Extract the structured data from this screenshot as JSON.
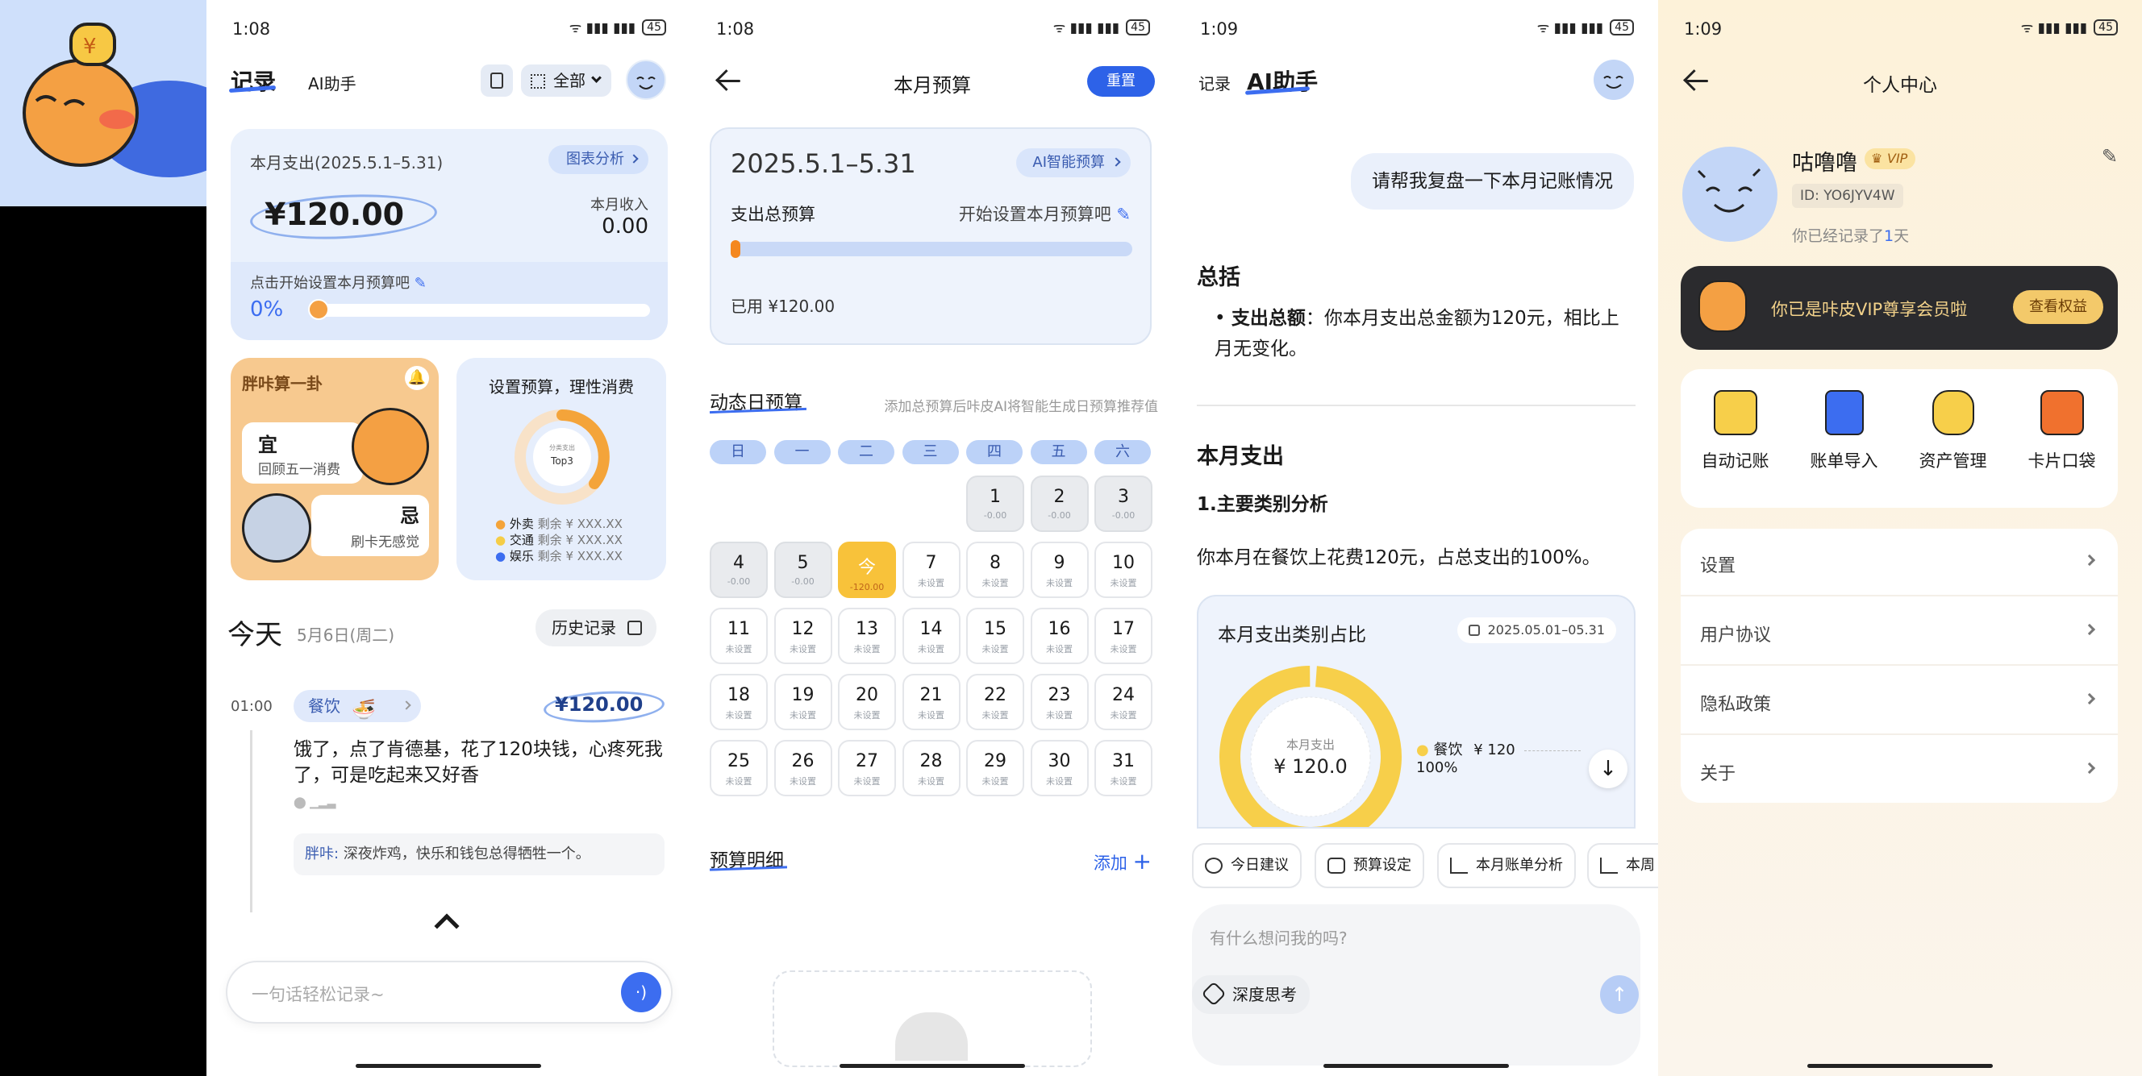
{
  "status": {
    "time1": "1:08",
    "time2": "1:08",
    "time3": "1:09",
    "time4": "1:09",
    "battery": "45",
    "signal": "ᯤ ▮▮▮ ▮▮▮"
  },
  "p1": {
    "tab_record": "记录",
    "tab_ai": "AI助手",
    "filter": "全部",
    "expense_title": "本月支出(2025.5.1–5.31)",
    "chart_btn": "图表分析",
    "expense_amount": "¥120.00",
    "income_label": "本月收入",
    "income_value": "0.00",
    "budget_hint": "点击开始设置本月预算吧",
    "budget_pct": "0%",
    "fortune_title": "胖咔算一卦",
    "yi": "宜",
    "yi_text": "回顾五一消费",
    "ji": "忌",
    "ji_text": "刷卡无感觉",
    "budget_card_title": "设置预算，理性消费",
    "donut_small": "分类支出",
    "donut_top": "Top3",
    "cats": [
      {
        "name": "外卖",
        "text": "剩余 ¥ XXX.XX",
        "color": "#f4a43a"
      },
      {
        "name": "交通",
        "text": "剩余 ¥ XXX.XX",
        "color": "#f5cd47"
      },
      {
        "name": "娱乐",
        "text": "剩余 ¥ XXX.XX",
        "color": "#3c6df0"
      }
    ],
    "today": "今天",
    "date": "5月6日(周二)",
    "history": "历史记录",
    "entry_time": "01:00",
    "entry_cat": "餐饮",
    "entry_amount": "¥120.00",
    "entry_text": "饿了，点了肯德基，花了120块钱，心疼死我了，可是吃起来又好香",
    "ai_reply_name": "胖咔:",
    "ai_reply": "深夜炸鸡，快乐和钱包总得牺牲一个。",
    "input_placeholder": "一句话轻松记录~"
  },
  "p2": {
    "title": "本月预算",
    "reset": "重置",
    "period": "2025.5.1–5.31",
    "ai_budget": "AI智能预算",
    "total_label": "支出总预算",
    "set_hint": "开始设置本月预算吧",
    "used": "已用 ¥120.00",
    "daily_title": "动态日预算",
    "daily_hint": "添加总预算后咔皮AI将智能生成日预算推荐值",
    "weekdays": [
      "日",
      "一",
      "二",
      "三",
      "四",
      "五",
      "六"
    ],
    "days": [
      {
        "d": "1",
        "s": "-0.00"
      },
      {
        "d": "2",
        "s": "-0.00"
      },
      {
        "d": "3",
        "s": "-0.00"
      },
      {
        "d": "4",
        "s": "-0.00"
      },
      {
        "d": "5",
        "s": "-0.00"
      },
      {
        "d": "今",
        "s": "-120.00"
      },
      {
        "d": "7",
        "s": "未设置"
      },
      {
        "d": "8",
        "s": "未设置"
      },
      {
        "d": "9",
        "s": "未设置"
      },
      {
        "d": "10",
        "s": "未设置"
      },
      {
        "d": "11",
        "s": "未设置"
      },
      {
        "d": "12",
        "s": "未设置"
      },
      {
        "d": "13",
        "s": "未设置"
      },
      {
        "d": "14",
        "s": "未设置"
      },
      {
        "d": "15",
        "s": "未设置"
      },
      {
        "d": "16",
        "s": "未设置"
      },
      {
        "d": "17",
        "s": "未设置"
      },
      {
        "d": "18",
        "s": "未设置"
      },
      {
        "d": "19",
        "s": "未设置"
      },
      {
        "d": "20",
        "s": "未设置"
      },
      {
        "d": "21",
        "s": "未设置"
      },
      {
        "d": "22",
        "s": "未设置"
      },
      {
        "d": "23",
        "s": "未设置"
      },
      {
        "d": "24",
        "s": "未设置"
      },
      {
        "d": "25",
        "s": "未设置"
      },
      {
        "d": "26",
        "s": "未设置"
      },
      {
        "d": "27",
        "s": "未设置"
      },
      {
        "d": "28",
        "s": "未设置"
      },
      {
        "d": "29",
        "s": "未设置"
      },
      {
        "d": "30",
        "s": "未设置"
      },
      {
        "d": "31",
        "s": "未设置"
      }
    ],
    "detail_title": "预算明细",
    "add": "添加"
  },
  "p3": {
    "tab_record": "记录",
    "tab_ai": "AI助手",
    "user_msg": "请帮我复盘一下本月记账情况",
    "h_summary": "总括",
    "bullet_bold": "支出总额",
    "bullet_text": "：你本月支出总金额为120元，相比上月无变化。",
    "h_month": "本月支出",
    "h_sub": "1.主要类别分析",
    "para": "你本月在餐饮上花费120元，占总支出的100%。",
    "chart_title": "本月支出类别占比",
    "chart_range": "2025.05.01–05.31",
    "donut_label": "本月支出",
    "donut_value": "¥ 120.0",
    "legend_name": "餐饮",
    "legend_amount": "¥ 120",
    "legend_pct": "100%",
    "chips": [
      "今日建议",
      "预算设定",
      "本月账单分析",
      "本周"
    ],
    "input_placeholder": "有什么想问我的吗?",
    "deep_think": "深度思考"
  },
  "p4": {
    "title": "个人中心",
    "name": "咕噜噜",
    "vip": "VIP",
    "id": "ID: YO6JYV4W",
    "days_text": "你已经记录了",
    "days_num": "1",
    "days_unit": "天",
    "vip_banner": "你已是咔皮VIP尊享会员啦",
    "vip_btn": "查看权益",
    "tools": [
      "自动记账",
      "账单导入",
      "资产管理",
      "卡片口袋"
    ],
    "menu": [
      "设置",
      "用户协议",
      "隐私政策",
      "关于"
    ]
  },
  "chart_data": {
    "type": "pie",
    "title": "本月支出类别占比",
    "categories": [
      "餐饮"
    ],
    "values": [
      120
    ],
    "percent": [
      100
    ]
  }
}
